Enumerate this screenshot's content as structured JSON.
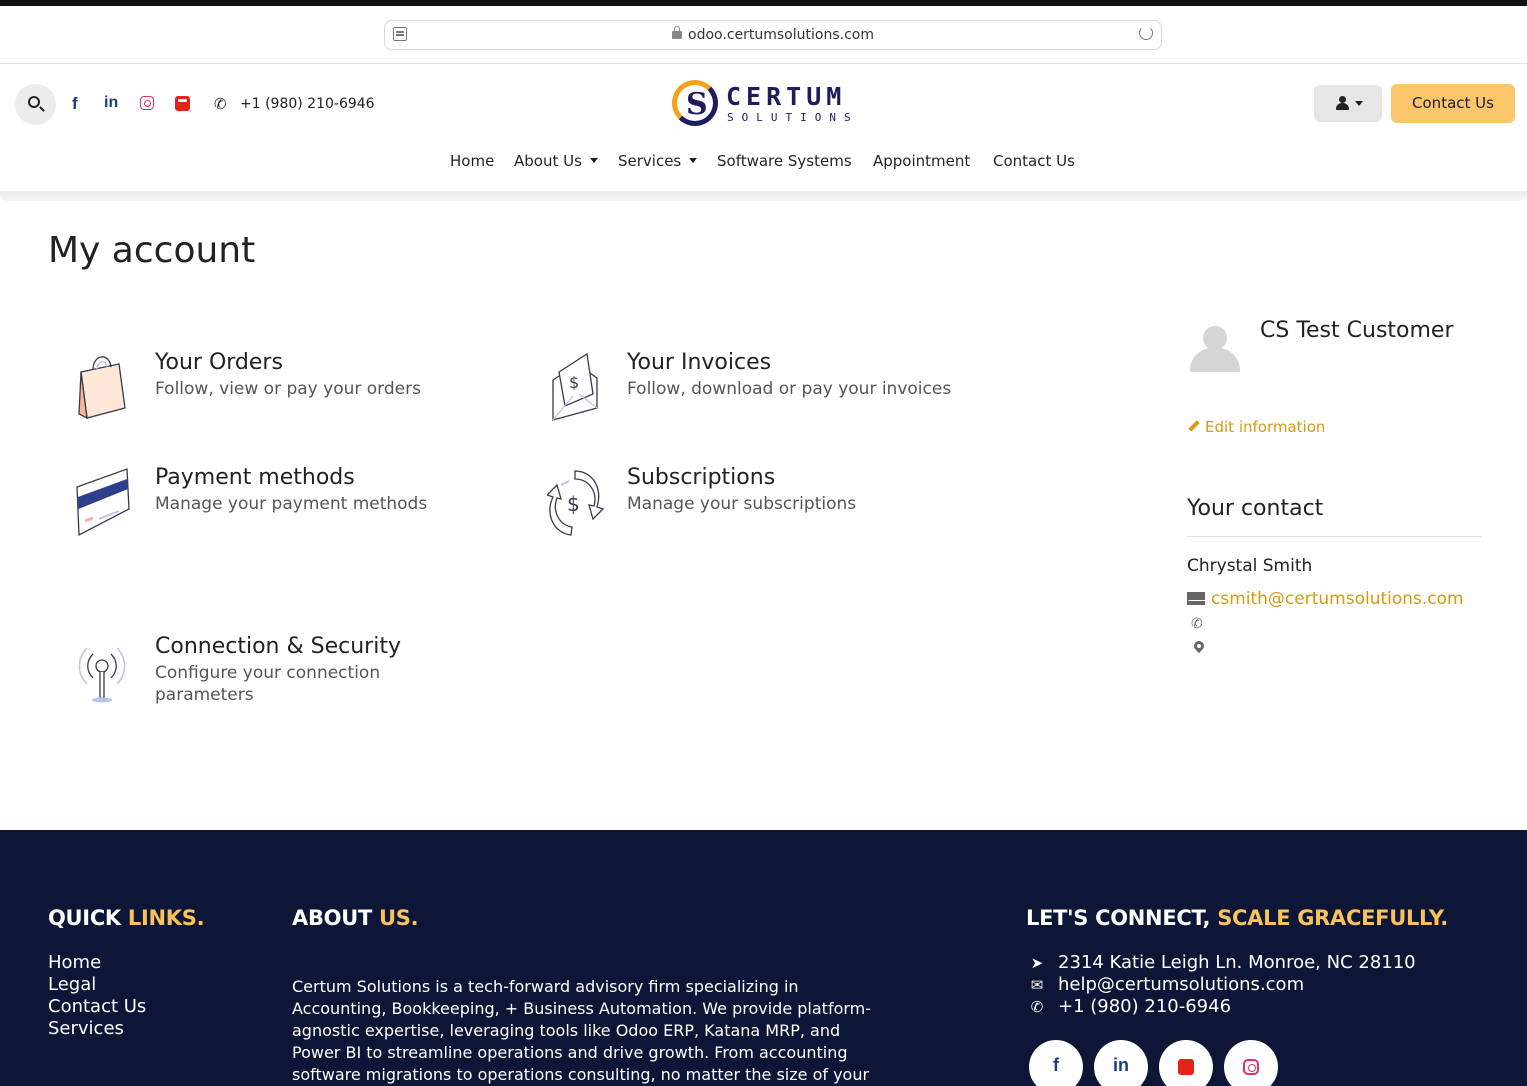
{
  "browser": {
    "url": "odoo.certumsolutions.com"
  },
  "header": {
    "phone": "+1 (980) 210-6946",
    "logo_top": "CERTUM",
    "logo_bottom": "SOLUTIONS",
    "contact_button": "Contact Us"
  },
  "nav": {
    "items": [
      {
        "label": "Home"
      },
      {
        "label": "About Us"
      },
      {
        "label": "Services"
      },
      {
        "label": "Software Systems"
      },
      {
        "label": "Appointment"
      },
      {
        "label": "Contact Us"
      }
    ]
  },
  "main": {
    "title": "My account",
    "cards": [
      {
        "title": "Your Orders",
        "desc": "Follow, view or pay your orders"
      },
      {
        "title": "Your Invoices",
        "desc": "Follow, download or pay your invoices"
      },
      {
        "title": "Payment methods",
        "desc": "Manage your payment methods"
      },
      {
        "title": "Subscriptions",
        "desc": "Manage your subscriptions"
      },
      {
        "title": "Connection & Security",
        "desc_line1": "Configure your connection",
        "desc_line2": "parameters"
      }
    ]
  },
  "profile": {
    "name": "CS Test Customer",
    "edit_label": "Edit information",
    "contact_heading": "Your contact",
    "contact_name": "Chrystal Smith",
    "contact_email": "csmith@certumsolutions.com"
  },
  "footer": {
    "quick_links_heading": "QUICK ",
    "quick_links_accent": "LINKS.",
    "links": [
      "Home",
      "Legal",
      "Contact Us",
      "Services"
    ],
    "about_heading": "ABOUT ",
    "about_accent": "US.",
    "about_text": "Certum Solutions is a tech-forward advisory firm specializing in Accounting, Bookkeeping, + Business Automation. We provide platform-agnostic expertise, leveraging tools like Odoo ERP, Katana MRP, and Power BI to streamline operations and drive growth. From accounting software migrations to operations consulting, no matter the size of your",
    "connect_heading": "LET'S CONNECT, ",
    "connect_accent": "SCALE GRACEFULLY.",
    "address": "2314 Katie Leigh Ln. Monroe, NC 28110",
    "email": "help@certumsolutions.com",
    "phone": "+1 (980) 210-6946"
  },
  "colors": {
    "accent": "#fbc56a",
    "link": "#d59a12",
    "footer_bg": "#0d1637"
  }
}
